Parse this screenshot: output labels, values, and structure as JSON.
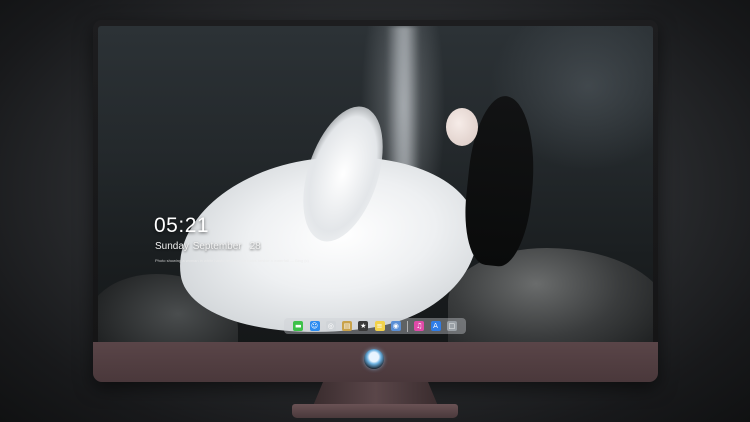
{
  "lock_screen": {
    "time": "05:21",
    "weekday_month": "Sunday September",
    "day": "28",
    "caption": "Photo showing a woman in white hanfu reclining on rocks beside a waterfall — Bing (c)"
  },
  "dock": {
    "icons": [
      {
        "name": "messages-icon",
        "glyph": "▬",
        "color": "#3ec14a"
      },
      {
        "name": "finder-icon",
        "glyph": "☺",
        "color": "#2d8cf0"
      },
      {
        "name": "safari-icon",
        "glyph": "◎",
        "color": "#d0d4d8"
      },
      {
        "name": "preview-icon",
        "glyph": "▤",
        "color": "#c9a24a"
      },
      {
        "name": "final-cut-icon",
        "glyph": "★",
        "color": "#3a3a3a"
      },
      {
        "name": "notes-icon",
        "glyph": "≡",
        "color": "#f2d24a"
      },
      {
        "name": "photos-icon",
        "glyph": "◉",
        "color": "#5a8fd6"
      },
      {
        "name": "itunes-icon",
        "glyph": "♫",
        "color": "#e04aa8"
      },
      {
        "name": "app-store-icon",
        "glyph": "A",
        "color": "#2f7de8"
      },
      {
        "name": "trash-icon",
        "glyph": "□",
        "color": "#9aa0a6"
      }
    ]
  },
  "colors": {
    "bezel": "#1d1d1f",
    "chin": "#5a4548",
    "stand": "#5a4649"
  }
}
